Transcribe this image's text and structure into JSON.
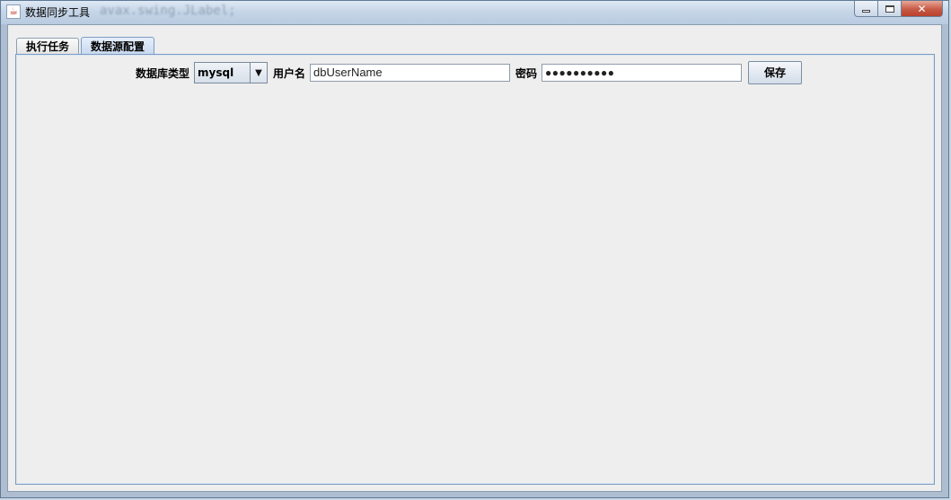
{
  "window": {
    "title": "数据同步工具",
    "ghost_text": "avax.swing.JLabel;",
    "icons": {
      "app": "java-app-icon",
      "minimize": "minimize-icon",
      "maximize": "maximize-icon",
      "close": "close-icon"
    }
  },
  "tabs": [
    {
      "label": "执行任务",
      "active": false
    },
    {
      "label": "数据源配置",
      "active": true
    }
  ],
  "form": {
    "db_type_label": "数据库类型",
    "db_type_value": "mysql",
    "username_label": "用户名",
    "username_value": "dbUserName",
    "password_label": "密码",
    "password_mask": "●●●●●●●●●●",
    "save_label": "保存"
  },
  "colors": {
    "tab_active": "#c7d8ee",
    "panel_border": "#7b9cc4",
    "close_button": "#c75a46"
  }
}
